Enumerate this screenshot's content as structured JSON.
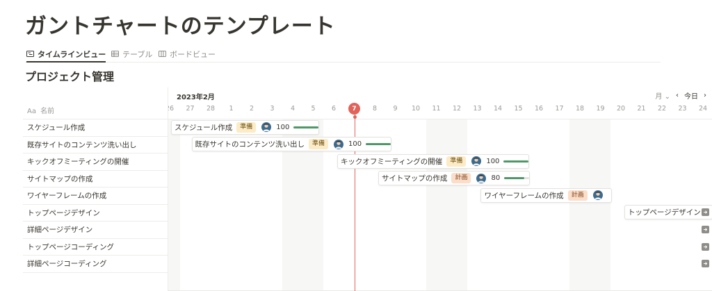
{
  "page": {
    "title": "ガントチャートのテンプレート"
  },
  "tabs": [
    {
      "label": "タイムラインビュー",
      "icon": "timeline-icon",
      "active": true
    },
    {
      "label": "テーブル",
      "icon": "table-icon",
      "active": false
    },
    {
      "label": "ボードビュー",
      "icon": "board-icon",
      "active": false
    }
  ],
  "database": {
    "title": "プロジェクト管理"
  },
  "table": {
    "name_prefix": "Aa",
    "name_header": "名前"
  },
  "rows": [
    "スケジュール作成",
    "既存サイトのコンテンツ洗い出し",
    "キックオフミーティングの開催",
    "サイトマップの作成",
    "ワイヤーフレームの作成",
    "トップページデザイン",
    "詳細ページデザイン",
    "トップページコーディング",
    "詳細ページコーディング"
  ],
  "timeline": {
    "month_label": "2023年2月",
    "view_select": "月",
    "today_button": "今日",
    "prev_icon": "chevron-left-icon",
    "next_icon": "chevron-right-icon",
    "days": [
      "26",
      "27",
      "28",
      "1",
      "2",
      "3",
      "4",
      "5",
      "6",
      "7",
      "8",
      "9",
      "10",
      "11",
      "12",
      "13",
      "14",
      "15",
      "16",
      "17",
      "18",
      "19",
      "20",
      "21",
      "22",
      "23",
      "24"
    ],
    "today_index": 9,
    "weekend_indices": [
      0,
      6,
      7,
      13,
      14,
      20,
      21
    ]
  },
  "bars": [
    {
      "name": "スケジュール作成",
      "status": "準備",
      "status_type": "prep",
      "progress_text": "100",
      "progress": 1.0,
      "start": 0.5,
      "end": 7.2
    },
    {
      "name": "既存サイトのコンテンツ洗い出し",
      "status": "準備",
      "status_type": "prep",
      "progress_text": "100",
      "progress": 1.0,
      "start": 1.5,
      "end": 8.5
    },
    {
      "name": "キックオフミーティングの開催",
      "status": "準備",
      "status_type": "prep",
      "progress_text": "100",
      "progress": 1.0,
      "start": 8.6,
      "end": 9.0
    },
    {
      "name": "サイトマップの作成",
      "status": "計画",
      "status_type": "plan",
      "progress_text": "80",
      "progress": 0.8,
      "start": 10.6,
      "end": 16.8
    },
    {
      "name": "ワイヤーフレームの作成",
      "status": "計画",
      "status_type": "plan",
      "progress_text": "",
      "progress": null,
      "start": 15.6,
      "end": 22.0
    },
    {
      "name": "トップページデザイン",
      "status": "",
      "status_type": "",
      "progress_text": "",
      "progress": null,
      "start": 22.6,
      "end": 27.0
    }
  ],
  "offscreen_rows": [
    6,
    7,
    8
  ],
  "colors": {
    "today": "#e16259",
    "progress": "#4f9768",
    "prep_badge": "#fbecc7",
    "plan_badge": "#fadec9"
  }
}
